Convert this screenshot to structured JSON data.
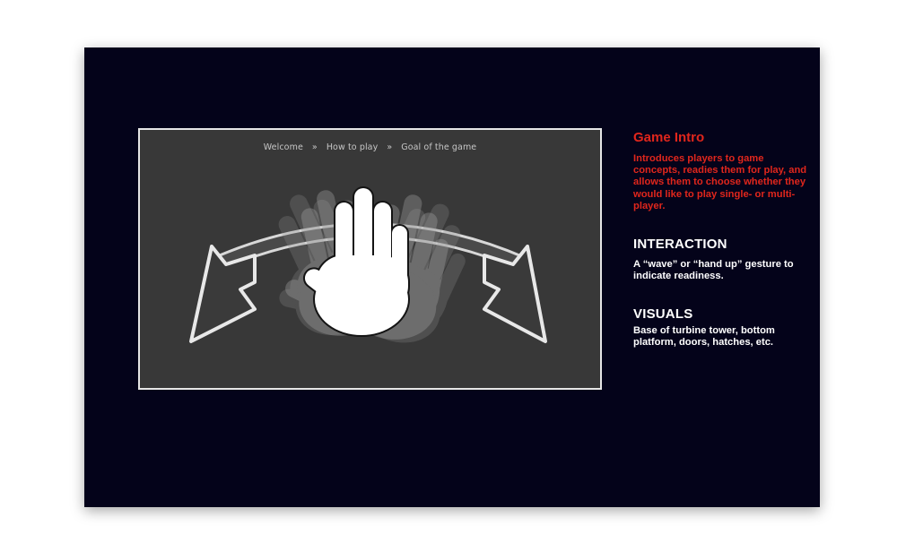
{
  "breadcrumb": {
    "items": [
      "Welcome",
      "How to play",
      "Goal of the game"
    ],
    "separator": "»"
  },
  "illustration": {
    "icons": [
      "wave-hand-icon",
      "swipe-left-arrow-icon",
      "swipe-right-arrow-icon"
    ]
  },
  "panel": {
    "intro_title": "Game Intro",
    "intro_text": "Introduces players to game concepts, readies them for play, and allows them to choose whether they would like to play single- or multi-player.",
    "interaction_title": "INTERACTION",
    "interaction_text": "A “wave” or “hand up” gesture to indicate readiness.",
    "visuals_title": "VISUALS",
    "visuals_text": "Base of turbine tower, bottom platform, doors, hatches, etc."
  },
  "colors": {
    "slide_bg": "#04031a",
    "preview_bg": "#383838",
    "accent_red": "#e0261c",
    "text_white": "#ffffff"
  }
}
